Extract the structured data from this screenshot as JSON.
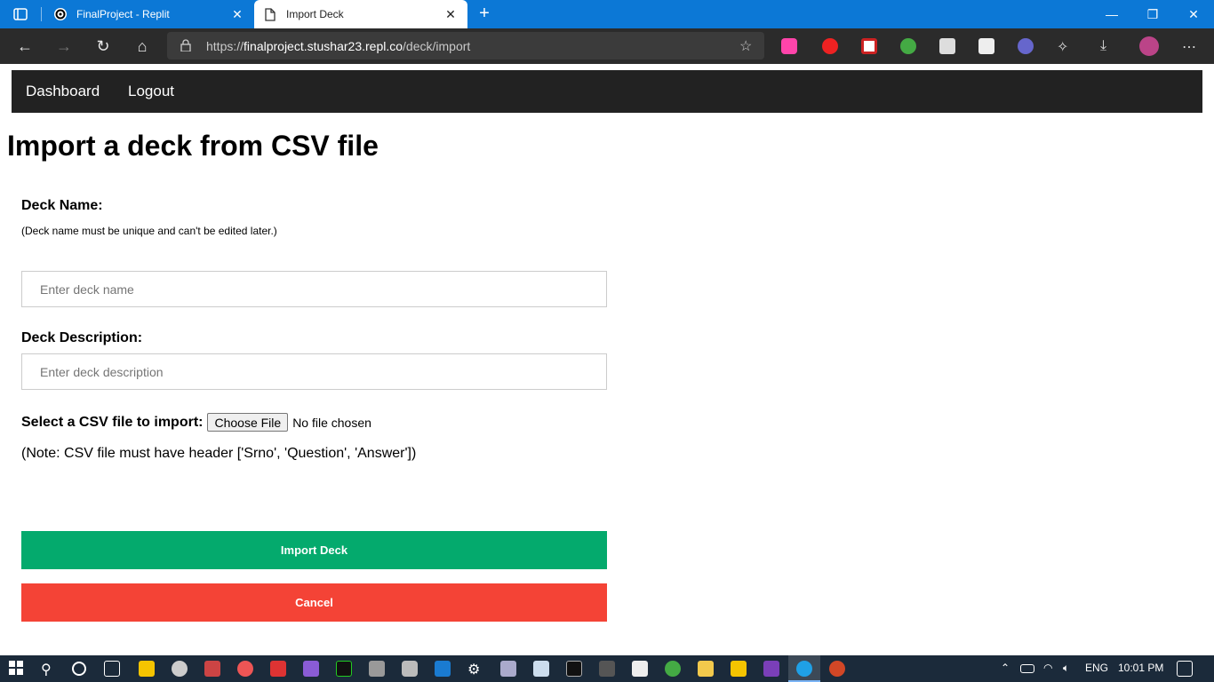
{
  "browser": {
    "tabs": [
      {
        "title": "FinalProject - Replit",
        "icon": "replit-icon"
      },
      {
        "title": "Import Deck",
        "icon": "page-icon"
      }
    ],
    "url": {
      "scheme": "https://",
      "host": "finalproject.stushar23.repl.co",
      "path": "/deck/import"
    }
  },
  "nav": {
    "dashboard": "Dashboard",
    "logout": "Logout"
  },
  "page": {
    "title": "Import a deck from CSV file"
  },
  "form": {
    "deck_name_label": "Deck Name:",
    "deck_name_hint": "(Deck name must be unique and can't be edited later.)",
    "deck_name_placeholder": "Enter deck name",
    "deck_desc_label": "Deck Description:",
    "deck_desc_placeholder": "Enter deck description",
    "file_label": "Select a CSV file to import:",
    "choose_file": "Choose File",
    "no_file": "No file chosen",
    "note": "(Note: CSV file must have header ['Srno', 'Question', 'Answer'])",
    "import_button": "Import Deck",
    "cancel_button": "Cancel"
  },
  "colors": {
    "nav_bg": "#222222",
    "import": "#04aa6d",
    "cancel": "#f44336",
    "tabbar": "#0c78d6"
  },
  "taskbar": {
    "language": "ENG",
    "time": "10:01 PM"
  }
}
